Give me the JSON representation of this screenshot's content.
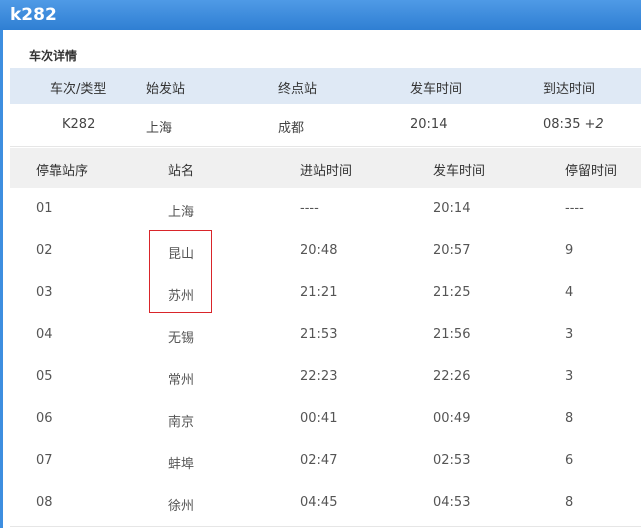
{
  "title": "k282",
  "section_title": "车次详情",
  "detail": {
    "headers": [
      "车次/类型",
      "始发站",
      "终点站",
      "发车时间",
      "到达时间"
    ],
    "train": "K282",
    "origin": "上海",
    "destination": "成都",
    "depart": "20:14",
    "arrive": "08:35",
    "arrive_plus": "+2"
  },
  "stops": {
    "headers": [
      "停靠站序",
      "站名",
      "进站时间",
      "发车时间",
      "停留时间"
    ],
    "rows": [
      [
        "01",
        "上海",
        "----",
        "20:14",
        "----"
      ],
      [
        "02",
        "昆山",
        "20:48",
        "20:57",
        "9"
      ],
      [
        "03",
        "苏州",
        "21:21",
        "21:25",
        "4"
      ],
      [
        "04",
        "无锡",
        "21:53",
        "21:56",
        "3"
      ],
      [
        "05",
        "常州",
        "22:23",
        "22:26",
        "3"
      ],
      [
        "06",
        "南京",
        "00:41",
        "00:49",
        "8"
      ],
      [
        "07",
        "蚌埠",
        "02:47",
        "02:53",
        "6"
      ],
      [
        "08",
        "徐州",
        "04:45",
        "04:53",
        "8"
      ]
    ]
  },
  "colors": {
    "titlebar": "#2f7fd3",
    "highlight": "#d9252a"
  }
}
